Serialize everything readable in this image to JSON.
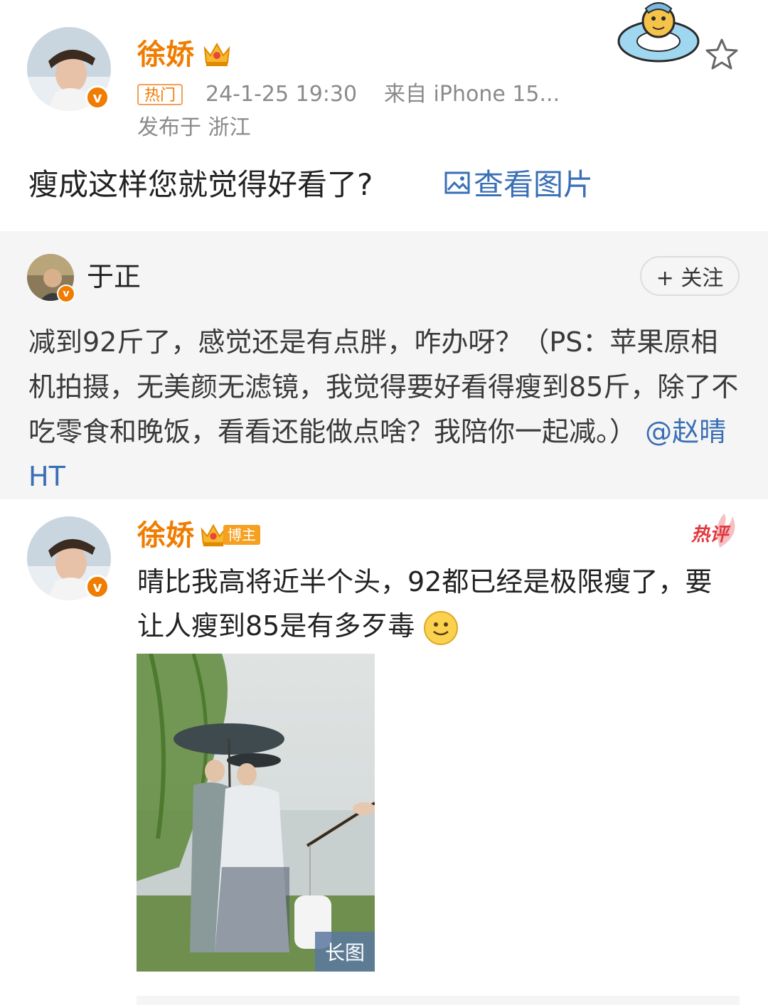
{
  "post": {
    "author_name": "徐娇",
    "hot_tag": "热门",
    "timestamp": "24-1-25 19:30",
    "source": "来自 iPhone 15...",
    "location": "发布于 浙江",
    "text": "瘦成这样您就觉得好看了?",
    "view_images_link": "查看图片"
  },
  "repost": {
    "author_name": "于正",
    "follow_label": "+ 关注",
    "text": "减到92斤了，感觉还是有点胖，咋办呀？（PS：苹果原相机拍摄，无美颜无滤镜，我觉得要好看得瘦到85斤，除了不吃零食和晚饭，看看还能做点啥？我陪你一起减。）",
    "mention": "@赵晴HT"
  },
  "comment": {
    "author_name": "徐娇",
    "blogger_badge": "博主",
    "hot_comment_tag": "热评",
    "text": "晴比我高将近半个头，92都已经是极限瘦了，要让人瘦到85是有多歹毒",
    "emoji": "🙂",
    "long_image_tag": "长图"
  },
  "colors": {
    "orange": "#f07c00",
    "link_blue": "#3a6fb5",
    "hot_red": "#e0383e",
    "gray_bg": "#f5f5f5"
  }
}
